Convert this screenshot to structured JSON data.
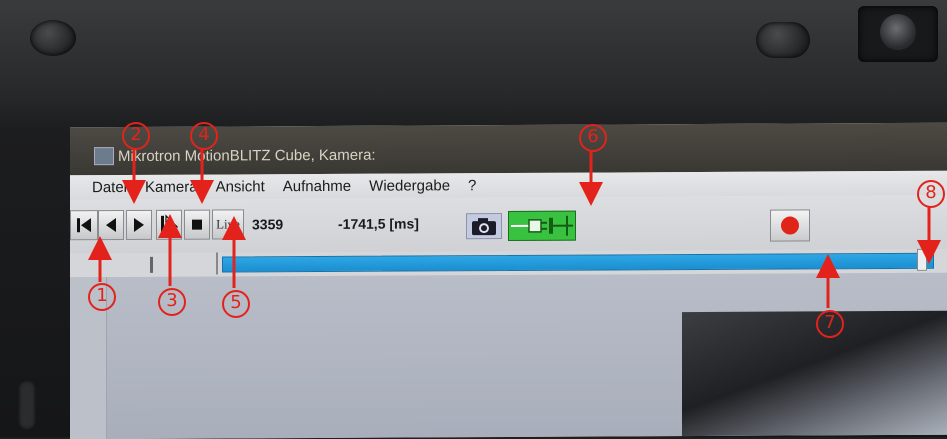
{
  "window": {
    "title": "Mikrotron MotionBLITZ Cube, Kamera:"
  },
  "menu": {
    "items": [
      "Datei",
      "Kamera",
      "Ansicht",
      "Aufnahme",
      "Wiedergabe",
      "?"
    ]
  },
  "toolbar": {
    "live_label": "Live",
    "frame_number": "3359",
    "time_value": "-1741,5 [ms]"
  },
  "timeline": {
    "position_fraction": 0.99
  },
  "annotations": {
    "labels": [
      "1",
      "2",
      "3",
      "4",
      "5",
      "6",
      "7",
      "8"
    ],
    "color": "#e3231b"
  },
  "icons": {
    "first": "skip-to-start-icon",
    "prev": "step-back-icon",
    "next": "step-forward-icon",
    "select": "cursor-select-icon",
    "stop": "stop-icon",
    "camera": "camera-icon",
    "connect": "plug-connect-icon",
    "record": "record-icon"
  }
}
